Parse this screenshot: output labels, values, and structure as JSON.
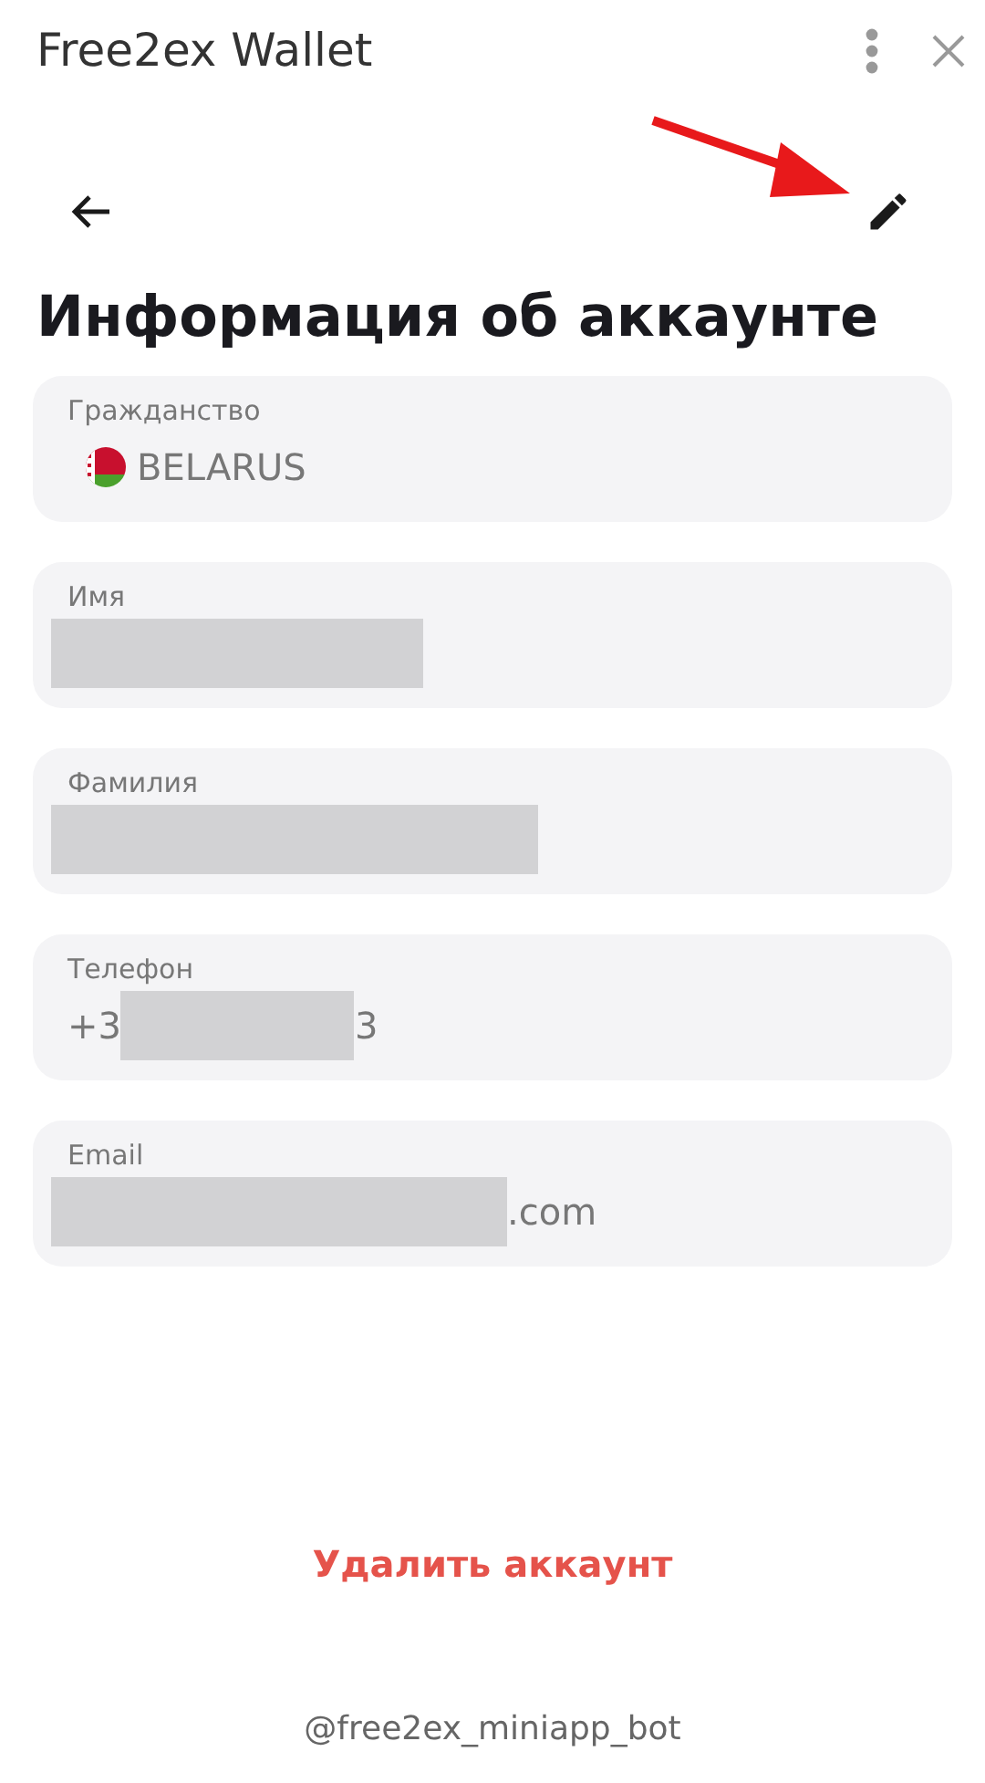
{
  "window": {
    "title": "Free2ex Wallet"
  },
  "annotation_arrow": true,
  "page_title": "Информация об аккаунте",
  "fields": [
    {
      "label": "Гражданство",
      "kind": "country",
      "value_before": "BELARUS"
    },
    {
      "label": "Имя",
      "kind": "masked"
    },
    {
      "label": "Фамилия",
      "kind": "masked"
    },
    {
      "label": "Телефон",
      "kind": "masked",
      "value_before": "+3",
      "value_after": "3"
    },
    {
      "label": "Email",
      "kind": "masked",
      "value_after": ".com"
    }
  ],
  "delete_button": "Удалить аккаунт",
  "footer": "@free2ex_miniapp_bot"
}
